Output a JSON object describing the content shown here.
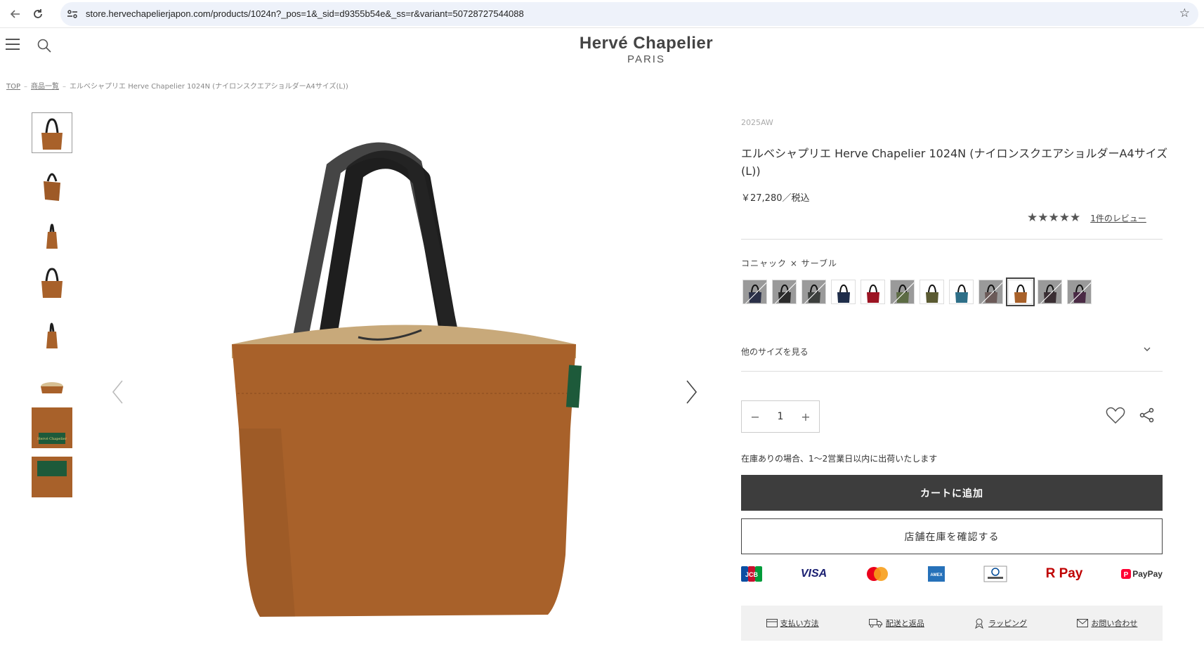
{
  "browser": {
    "url": "store.hervechapelierjapon.com/products/1024n?_pos=1&_sid=d9355b54e&_ss=r&variant=50728727544088"
  },
  "header": {
    "logo_main": "Hervé Chapelier",
    "logo_sub": "PARIS"
  },
  "breadcrumb": {
    "items": [
      "TOP",
      "商品一覧",
      "エルベシャプリエ Herve Chapelier 1024N (ナイロンスクエアショルダーA4サイズ(L))"
    ],
    "separator": "–"
  },
  "product": {
    "season": "2025AW",
    "title": "エルベシャプリエ Herve Chapelier 1024N (ナイロンスクエアショルダーA4サイズ(L))",
    "price": "￥27,280／税込",
    "rating": 5,
    "review_link": "1件のレビュー",
    "color_label": "コニャック × サーブル",
    "other_size": "他のサイズを見る",
    "quantity": "1",
    "stock_note": "在庫ありの場合、1〜2営業日以内に出荷いたします",
    "add_to_cart": "カートに追加",
    "check_store": "店舗在庫を確認する"
  },
  "swatches": [
    {
      "color": "#2a3048",
      "soldout": true
    },
    {
      "color": "#2b2b2b",
      "soldout": true
    },
    {
      "color": "#3c3f3d",
      "soldout": true
    },
    {
      "color": "#1f2d4a",
      "soldout": false
    },
    {
      "color": "#9b1322",
      "soldout": false
    },
    {
      "color": "#5c6b44",
      "soldout": true
    },
    {
      "color": "#5a5a32",
      "soldout": false
    },
    {
      "color": "#2e6f88",
      "soldout": false
    },
    {
      "color": "#6b5a58",
      "soldout": true
    },
    {
      "color": "#a8612a",
      "soldout": false,
      "selected": true
    },
    {
      "color": "#3a2e33",
      "soldout": true
    },
    {
      "color": "#4a2a45",
      "soldout": true
    }
  ],
  "payments": [
    "JCB",
    "VISA",
    "Mastercard",
    "AMEX",
    "Diners Club",
    "R Pay",
    "PayPay"
  ],
  "footer_links": [
    {
      "label": "支払い方法",
      "icon": "card-icon"
    },
    {
      "label": "配送と返品",
      "icon": "truck-icon"
    },
    {
      "label": "ラッピング",
      "icon": "gift-icon"
    },
    {
      "label": "お問い合わせ",
      "icon": "mail-icon"
    }
  ],
  "colors": {
    "bag_body": "#a8612a",
    "bag_handle": "#1e1e1e",
    "bag_lining": "#c8a97a",
    "button_dark": "#3d3d3d"
  }
}
